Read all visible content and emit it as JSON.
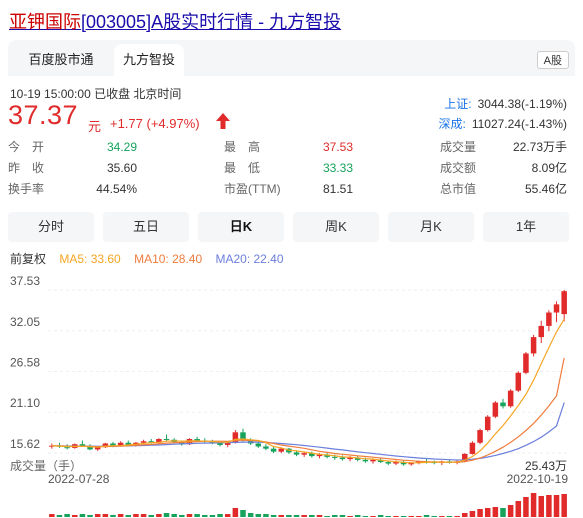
{
  "header": {
    "name": "亚钾国际",
    "code": "[003005]",
    "rest": "A股实时行情 - 九方智投"
  },
  "tabs": [
    {
      "label": "百度股市通"
    },
    {
      "label": "九方智投"
    }
  ],
  "market_badge": "A股",
  "timestamp": "10-19 15:00:00  已收盘  北京时间",
  "price": "37.37",
  "price_unit": "元",
  "change": "+1.77 (+4.97%)",
  "indices": [
    {
      "name": "上证:",
      "value": "3044.38(-1.19%)"
    },
    {
      "name": "深成:",
      "value": "11027.24(-1.43%)"
    }
  ],
  "stats": [
    [
      {
        "label": "今　开",
        "value": "34.29",
        "color": "green"
      },
      {
        "label": "最　高",
        "value": "37.53",
        "color": "red"
      },
      {
        "label": "成交量",
        "value": "22.73万手",
        "color": "dark"
      }
    ],
    [
      {
        "label": "昨　收",
        "value": "35.60",
        "color": "dark"
      },
      {
        "label": "最　低",
        "value": "33.33",
        "color": "green"
      },
      {
        "label": "成交额",
        "value": "8.09亿",
        "color": "dark"
      }
    ],
    [
      {
        "label": "换手率",
        "value": "44.54%",
        "color": "dark"
      },
      {
        "label": "市盈(TTM)",
        "value": "81.51",
        "color": "dark"
      },
      {
        "label": "总市值",
        "value": "55.46亿",
        "color": "dark"
      }
    ]
  ],
  "period_tabs": [
    "分时",
    "五日",
    "日K",
    "周K",
    "月K",
    "1年"
  ],
  "active_period": "日K",
  "ma_legend": {
    "adjust": "前复权",
    "ma5": "MA5: 33.60",
    "ma10": "MA10: 28.40",
    "ma20": "MA20: 22.40"
  },
  "colors": {
    "up": "#e12b2b",
    "down": "#17a35c",
    "ma5": "#f5a623",
    "ma10": "#f07c3c",
    "ma20": "#6b7fdc"
  },
  "volume": {
    "label": "成交量（手）",
    "max": "25.43万"
  },
  "chart_data": {
    "type": "candlestick",
    "y_ticks": [
      "37.53",
      "32.05",
      "26.58",
      "21.10",
      "15.62"
    ],
    "ylim": [
      15.62,
      37.53
    ],
    "x_ticks": [
      "2022-07-28",
      "2022-10-19"
    ],
    "ohlc": [
      [
        16.6,
        16.9,
        16.2,
        16.6
      ],
      [
        16.6,
        17.0,
        16.3,
        16.5
      ],
      [
        16.4,
        16.8,
        16.1,
        16.3
      ],
      [
        16.3,
        16.9,
        16.2,
        16.8
      ],
      [
        16.8,
        17.3,
        16.5,
        16.6
      ],
      [
        16.6,
        16.8,
        16.0,
        16.1
      ],
      [
        16.1,
        16.5,
        15.9,
        16.4
      ],
      [
        16.4,
        17.0,
        16.3,
        16.9
      ],
      [
        16.9,
        17.1,
        16.4,
        16.6
      ],
      [
        16.6,
        17.2,
        16.5,
        17.0
      ],
      [
        17.0,
        17.3,
        16.6,
        16.7
      ],
      [
        16.7,
        17.1,
        16.5,
        17.0
      ],
      [
        17.0,
        17.4,
        16.8,
        17.2
      ],
      [
        17.2,
        17.5,
        16.9,
        17.0
      ],
      [
        17.0,
        17.6,
        16.9,
        17.5
      ],
      [
        17.5,
        18.1,
        17.2,
        17.4
      ],
      [
        17.4,
        17.6,
        16.9,
        17.1
      ],
      [
        17.1,
        17.3,
        16.6,
        16.8
      ],
      [
        16.8,
        17.6,
        16.7,
        17.5
      ],
      [
        17.5,
        17.8,
        17.1,
        17.3
      ],
      [
        17.3,
        17.6,
        17.0,
        17.2
      ],
      [
        17.2,
        17.4,
        16.8,
        17.0
      ],
      [
        17.0,
        17.2,
        16.5,
        16.7
      ],
      [
        16.7,
        17.1,
        16.4,
        17.0
      ],
      [
        17.0,
        18.7,
        16.9,
        18.4
      ],
      [
        18.4,
        18.9,
        17.1,
        17.3
      ],
      [
        17.3,
        17.6,
        16.7,
        16.9
      ],
      [
        16.9,
        17.1,
        16.3,
        16.5
      ],
      [
        16.5,
        16.8,
        16.0,
        16.2
      ],
      [
        16.2,
        16.5,
        15.6,
        15.8
      ],
      [
        15.8,
        16.4,
        15.6,
        16.2
      ],
      [
        16.2,
        16.3,
        15.5,
        15.7
      ],
      [
        15.7,
        16.0,
        15.2,
        15.4
      ],
      [
        15.4,
        15.8,
        15.1,
        15.6
      ],
      [
        15.6,
        15.8,
        15.0,
        15.2
      ],
      [
        15.2,
        15.6,
        14.9,
        15.4
      ],
      [
        15.4,
        15.6,
        14.9,
        15.1
      ],
      [
        15.1,
        15.4,
        14.7,
        15.0
      ],
      [
        15.0,
        15.3,
        14.6,
        14.8
      ],
      [
        14.8,
        15.2,
        14.5,
        15.0
      ],
      [
        15.0,
        15.2,
        14.5,
        14.7
      ],
      [
        14.7,
        15.0,
        14.3,
        14.5
      ],
      [
        14.5,
        14.9,
        14.2,
        14.7
      ],
      [
        14.7,
        14.9,
        14.3,
        14.4
      ],
      [
        14.4,
        14.6,
        14.0,
        14.2
      ],
      [
        14.2,
        14.6,
        14.0,
        14.4
      ],
      [
        14.4,
        14.6,
        13.9,
        14.1
      ],
      [
        14.1,
        14.4,
        13.9,
        14.3
      ],
      [
        14.3,
        14.6,
        14.1,
        14.5
      ],
      [
        14.5,
        14.8,
        14.2,
        14.4
      ],
      [
        14.4,
        14.6,
        14.1,
        14.3
      ],
      [
        14.3,
        14.6,
        14.0,
        14.5
      ],
      [
        14.5,
        14.7,
        14.2,
        14.3
      ],
      [
        14.3,
        14.6,
        14.1,
        14.5
      ],
      [
        14.5,
        15.6,
        14.4,
        15.5
      ],
      [
        15.5,
        17.2,
        15.4,
        17.0
      ],
      [
        17.0,
        18.9,
        16.8,
        18.7
      ],
      [
        18.7,
        20.7,
        18.5,
        20.5
      ],
      [
        20.5,
        22.6,
        20.3,
        22.4
      ],
      [
        22.4,
        22.9,
        21.6,
        21.9
      ],
      [
        21.9,
        24.2,
        21.7,
        24.0
      ],
      [
        24.0,
        26.6,
        23.8,
        26.4
      ],
      [
        26.4,
        29.2,
        26.2,
        29.0
      ],
      [
        29.0,
        31.5,
        28.6,
        31.2
      ],
      [
        31.2,
        33.4,
        30.4,
        32.7
      ],
      [
        32.7,
        34.8,
        32.0,
        34.5
      ],
      [
        34.5,
        36.0,
        33.2,
        35.6
      ],
      [
        34.29,
        37.53,
        33.33,
        37.37
      ]
    ],
    "ma5": [
      16.6,
      16.55,
      16.5,
      16.5,
      16.55,
      16.45,
      16.4,
      16.55,
      16.6,
      16.6,
      16.7,
      16.8,
      16.9,
      17.0,
      17.05,
      17.2,
      17.25,
      17.2,
      17.25,
      17.25,
      17.2,
      17.15,
      17.1,
      17.05,
      17.45,
      17.5,
      17.4,
      17.3,
      17.0,
      16.5,
      16.3,
      16.0,
      15.9,
      15.75,
      15.6,
      15.45,
      15.35,
      15.25,
      15.1,
      15.05,
      14.95,
      14.85,
      14.8,
      14.65,
      14.55,
      14.45,
      14.35,
      14.3,
      14.3,
      14.35,
      14.4,
      14.4,
      14.4,
      14.4,
      14.65,
      15.15,
      15.9,
      16.95,
      18.2,
      19.3,
      20.6,
      22.0,
      23.5,
      25.4,
      27.6,
      29.8,
      31.9,
      33.6
    ],
    "ma10": [
      16.6,
      16.57,
      16.53,
      16.52,
      16.52,
      16.5,
      16.47,
      16.5,
      16.52,
      16.55,
      16.6,
      16.65,
      16.72,
      16.78,
      16.85,
      16.95,
      17.0,
      17.05,
      17.1,
      17.15,
      17.18,
      17.2,
      17.2,
      17.18,
      17.3,
      17.35,
      17.3,
      17.25,
      17.1,
      16.9,
      16.7,
      16.55,
      16.4,
      16.25,
      16.05,
      15.85,
      15.7,
      15.55,
      15.45,
      15.35,
      15.25,
      15.15,
      15.05,
      14.95,
      14.85,
      14.75,
      14.65,
      14.58,
      14.5,
      14.45,
      14.42,
      14.4,
      14.38,
      14.37,
      14.45,
      14.65,
      14.95,
      15.35,
      15.85,
      16.4,
      17.05,
      17.8,
      18.65,
      19.6,
      20.7,
      21.95,
      23.3,
      28.4
    ],
    "ma20": [
      16.6,
      16.58,
      16.56,
      16.55,
      16.55,
      16.54,
      16.53,
      16.54,
      16.55,
      16.56,
      16.58,
      16.6,
      16.63,
      16.67,
      16.7,
      16.75,
      16.8,
      16.84,
      16.88,
      16.92,
      16.95,
      16.97,
      16.99,
      17.0,
      17.05,
      17.08,
      17.08,
      17.07,
      17.03,
      16.97,
      16.9,
      16.82,
      16.73,
      16.63,
      16.52,
      16.4,
      16.28,
      16.15,
      16.03,
      15.9,
      15.78,
      15.66,
      15.55,
      15.44,
      15.33,
      15.22,
      15.12,
      15.03,
      14.95,
      14.88,
      14.82,
      14.77,
      14.72,
      14.68,
      14.7,
      14.78,
      14.9,
      15.08,
      15.3,
      15.55,
      15.85,
      16.2,
      16.65,
      17.15,
      17.75,
      18.45,
      19.25,
      22.4
    ],
    "volume": [
      3,
      2,
      3,
      2,
      3,
      2,
      3,
      3,
      2,
      3,
      2,
      3,
      3,
      2,
      3,
      4,
      3,
      2,
      3,
      3,
      2,
      2,
      3,
      3,
      9,
      7,
      4,
      3,
      3,
      2,
      2,
      2,
      2,
      2,
      2,
      2,
      1,
      2,
      2,
      1,
      2,
      1,
      1,
      2,
      1,
      1,
      1,
      1,
      1,
      2,
      1,
      1,
      1,
      1,
      4,
      6,
      8,
      9,
      10,
      9,
      12,
      16,
      20,
      24,
      21,
      22,
      22,
      23
    ]
  }
}
